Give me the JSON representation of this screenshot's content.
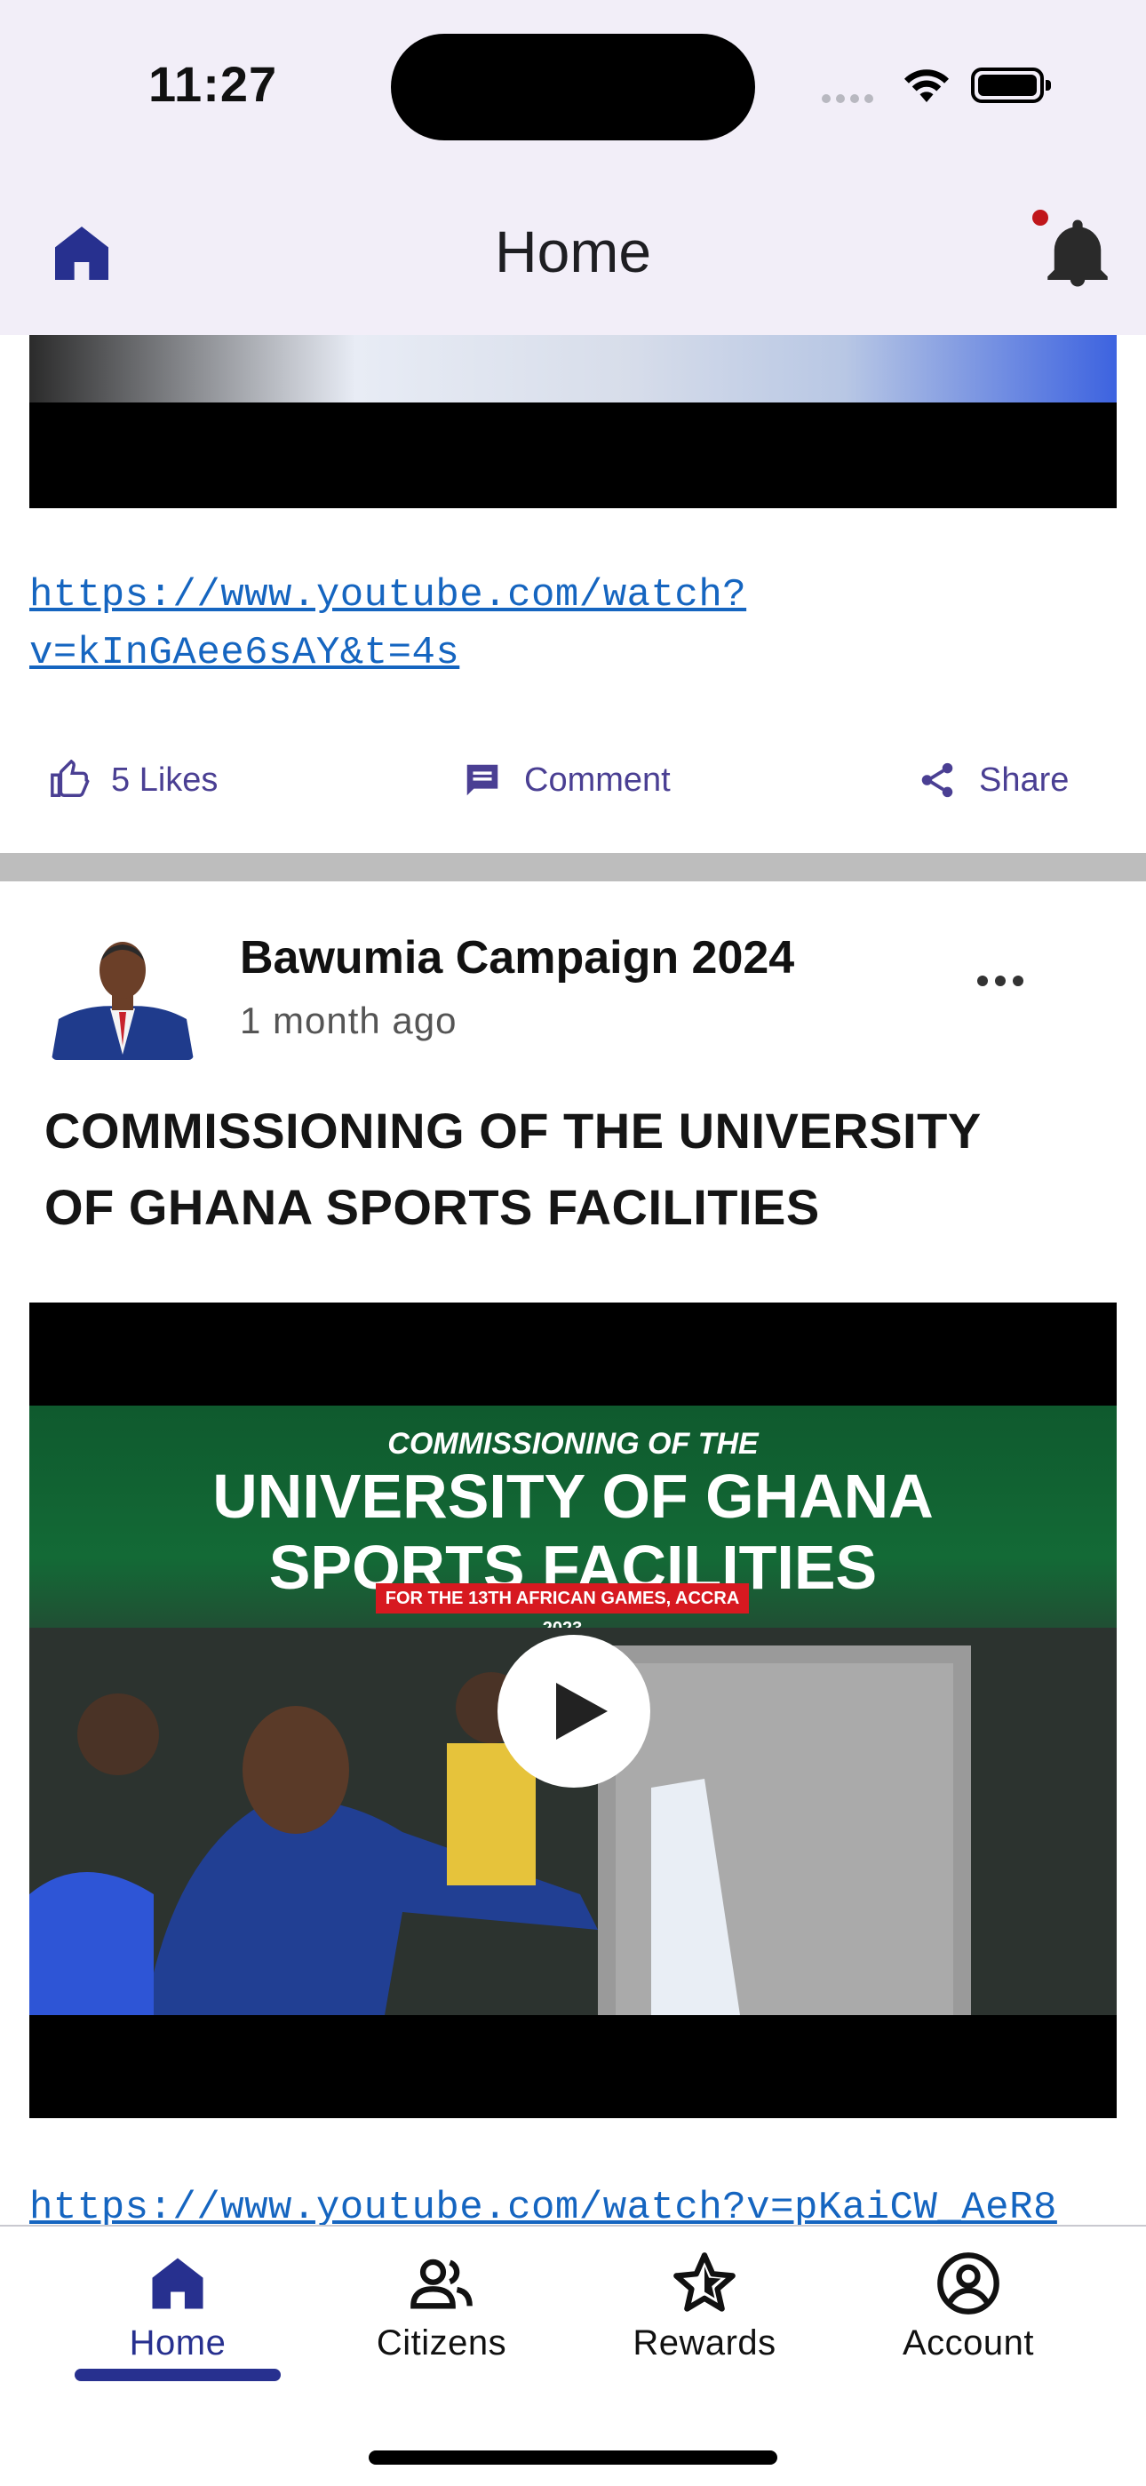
{
  "status_bar": {
    "time": "11:27"
  },
  "app_bar": {
    "title": "Home"
  },
  "post1": {
    "link_line1": "https://www.youtube.com/watch?",
    "link_line2": "v=kInGAee6sAY&t=4s",
    "likes_label": "5 Likes",
    "comment_label": "Comment",
    "share_label": "Share"
  },
  "post2": {
    "author": "Bawumia Campaign 2024",
    "time_ago": "1 month ago",
    "title_line1": "COMMISSIONING OF THE UNIVERSITY",
    "title_line2": "OF GHANA SPORTS FACILITIES",
    "thumbnail": {
      "line1": "COMMISSIONING OF THE",
      "line2": "UNIVERSITY OF GHANA",
      "line3": "SPORTS FACILITIES",
      "badge": "FOR THE 13TH AFRICAN GAMES, ACCRA 2023"
    },
    "link": "https://www.youtube.com/watch?v=pKaiCW_AeR8"
  },
  "bottom_nav": {
    "items": [
      {
        "label": "Home",
        "icon": "home-icon",
        "active": true
      },
      {
        "label": "Citizens",
        "icon": "people-icon",
        "active": false
      },
      {
        "label": "Rewards",
        "icon": "star-icon",
        "active": false
      },
      {
        "label": "Account",
        "icon": "account-circle-icon",
        "active": false
      }
    ]
  },
  "colors": {
    "accent": "#27308f",
    "link": "#1565c0",
    "action": "#4a3f93",
    "notification_dot": "#c0161b",
    "appbar_bg": "#f2eef8"
  }
}
